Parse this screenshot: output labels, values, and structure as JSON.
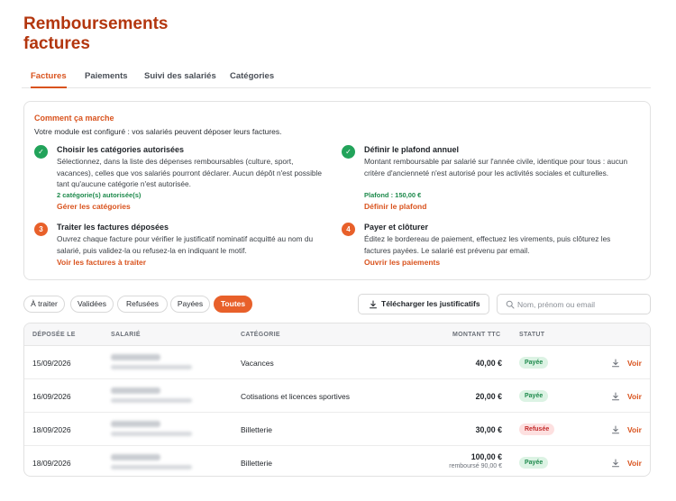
{
  "page": {
    "title": "Remboursements factures"
  },
  "tabs": [
    {
      "label": "Factures",
      "active": true
    },
    {
      "label": "Paiements",
      "active": false
    },
    {
      "label": "Suivi des salariés",
      "active": false
    },
    {
      "label": "Catégories",
      "active": false
    }
  ],
  "howto": {
    "title": "Comment ça marche",
    "intro": "Votre module est configuré : vos salariés peuvent déposer leurs factures.",
    "steps": [
      {
        "badge": "✓",
        "title": "Choisir les catégories autorisées",
        "text": "Sélectionnez, dans la liste des dépenses remboursables (culture, sport, vacances), celles que vos salariés pourront déclarer. Aucun dépôt n'est possible tant qu'aucune catégorie n'est autorisée.",
        "meta": "2 catégorie(s) autorisée(s)",
        "link": "Gérer les catégories"
      },
      {
        "badge": "✓",
        "title": "Définir le plafond annuel",
        "text": "Montant remboursable par salarié sur l'année civile, identique pour tous : aucun critère d'ancienneté n'est autorisé pour les activités sociales et culturelles.",
        "meta": "Plafond : 150,00 €",
        "link": "Définir le plafond"
      },
      {
        "badge": "3",
        "title": "Traiter les factures déposées",
        "text": "Ouvrez chaque facture pour vérifier le justificatif nominatif acquitté au nom du salarié, puis validez-la ou refusez-la en indiquant le motif.",
        "link": "Voir les factures à traiter"
      },
      {
        "badge": "4",
        "title": "Payer et clôturer",
        "text": "Éditez le bordereau de paiement, effectuez les virements, puis clôturez les factures payées. Le salarié est prévenu par email.",
        "link": "Ouvrir les paiements"
      }
    ]
  },
  "filters": [
    {
      "label": "À traiter",
      "active": false
    },
    {
      "label": "Validées",
      "active": false
    },
    {
      "label": "Refusées",
      "active": false
    },
    {
      "label": "Payées",
      "active": false
    },
    {
      "label": "Toutes",
      "active": true
    }
  ],
  "download_button": {
    "label": "Télécharger les justificatifs",
    "icon": "download-icon"
  },
  "search": {
    "placeholder": "Nom, prénom ou email",
    "value": "",
    "icon": "search-icon"
  },
  "table": {
    "headers": {
      "date": "DÉPOSÉE LE",
      "employee": "SALARIÉ",
      "category": "CATÉGORIE",
      "amount": "MONTANT TTC",
      "status": "STATUT"
    },
    "rows": [
      {
        "date": "15/09/2026",
        "category": "Vacances",
        "amount": "40,00 €",
        "status": "Payée",
        "status_kind": "paid",
        "action": "Voir"
      },
      {
        "date": "16/09/2026",
        "category": "Cotisations et licences sportives",
        "amount": "20,00 €",
        "status": "Payée",
        "status_kind": "paid",
        "action": "Voir"
      },
      {
        "date": "18/09/2026",
        "category": "Billetterie",
        "amount": "30,00 €",
        "status": "Refusée",
        "status_kind": "refused",
        "action": "Voir"
      },
      {
        "date": "18/09/2026",
        "category": "Billetterie",
        "amount": "100,00 €",
        "amount_sub": "remboursé 90,00 €",
        "status": "Payée",
        "status_kind": "paid",
        "action": "Voir"
      }
    ]
  },
  "colors": {
    "brand": "#d9531e",
    "title": "#b3360e",
    "success": "#22a35a",
    "danger": "#c42b2b"
  }
}
